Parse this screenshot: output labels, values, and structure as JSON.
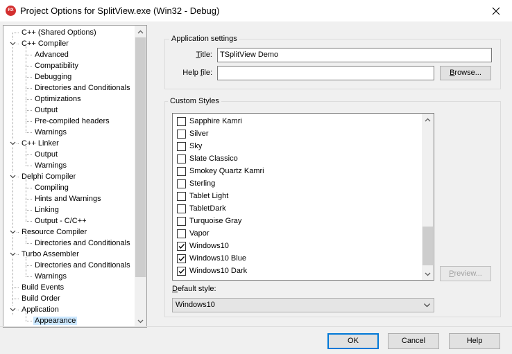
{
  "window": {
    "title": "Project Options for SplitView.exe  (Win32 - Debug)",
    "logo_text": "RX"
  },
  "tree": {
    "items": [
      {
        "label": "C++ (Shared Options)",
        "level": 0,
        "expander": "none"
      },
      {
        "label": "C++ Compiler",
        "level": 0,
        "expander": "expanded"
      },
      {
        "label": "Advanced",
        "level": 1
      },
      {
        "label": "Compatibility",
        "level": 1
      },
      {
        "label": "Debugging",
        "level": 1
      },
      {
        "label": "Directories and Conditionals",
        "level": 1
      },
      {
        "label": "Optimizations",
        "level": 1
      },
      {
        "label": "Output",
        "level": 1
      },
      {
        "label": "Pre-compiled headers",
        "level": 1
      },
      {
        "label": "Warnings",
        "level": 1
      },
      {
        "label": "C++ Linker",
        "level": 0,
        "expander": "expanded"
      },
      {
        "label": "Output",
        "level": 1
      },
      {
        "label": "Warnings",
        "level": 1
      },
      {
        "label": "Delphi Compiler",
        "level": 0,
        "expander": "expanded"
      },
      {
        "label": "Compiling",
        "level": 1
      },
      {
        "label": "Hints and Warnings",
        "level": 1
      },
      {
        "label": "Linking",
        "level": 1
      },
      {
        "label": "Output - C/C++",
        "level": 1
      },
      {
        "label": "Resource Compiler",
        "level": 0,
        "expander": "expanded"
      },
      {
        "label": "Directories and Conditionals",
        "level": 1
      },
      {
        "label": "Turbo Assembler",
        "level": 0,
        "expander": "expanded"
      },
      {
        "label": "Directories and Conditionals",
        "level": 1
      },
      {
        "label": "Warnings",
        "level": 1
      },
      {
        "label": "Build Events",
        "level": 0,
        "expander": "none"
      },
      {
        "label": "Build Order",
        "level": 0,
        "expander": "none"
      },
      {
        "label": "Application",
        "level": 0,
        "expander": "expanded"
      },
      {
        "label": "Appearance",
        "level": 1,
        "selected": true
      }
    ]
  },
  "app_settings": {
    "caption": "Application settings",
    "title_label_pre": "",
    "title_label_accel": "T",
    "title_label_post": "itle:",
    "title_value": "TSplitView Demo",
    "helpfile_label_pre": "Help ",
    "helpfile_label_accel": "f",
    "helpfile_label_post": "ile:",
    "helpfile_value": "",
    "browse_pre": "",
    "browse_accel": "B",
    "browse_post": "rowse..."
  },
  "custom_styles": {
    "caption": "Custom Styles",
    "items": [
      {
        "label": "Sapphire Kamri",
        "checked": false
      },
      {
        "label": "Silver",
        "checked": false
      },
      {
        "label": "Sky",
        "checked": false
      },
      {
        "label": "Slate Classico",
        "checked": false
      },
      {
        "label": "Smokey Quartz Kamri",
        "checked": false
      },
      {
        "label": "Sterling",
        "checked": false
      },
      {
        "label": "Tablet Light",
        "checked": false
      },
      {
        "label": "TabletDark",
        "checked": false
      },
      {
        "label": "Turquoise Gray",
        "checked": false
      },
      {
        "label": "Vapor",
        "checked": false
      },
      {
        "label": "Windows10",
        "checked": true
      },
      {
        "label": "Windows10 Blue",
        "checked": true
      },
      {
        "label": "Windows10 Dark",
        "checked": true
      }
    ],
    "preview_pre": "",
    "preview_accel": "P",
    "preview_post": "review..."
  },
  "default_style": {
    "label_pre": "",
    "label_accel": "D",
    "label_post": "efault style:",
    "value": "Windows10"
  },
  "footer": {
    "ok": "OK",
    "cancel": "Cancel",
    "help": "Help"
  },
  "colors": {
    "selection": "#cce8ff",
    "accent": "#0078d7",
    "logo": "#d32f2f"
  }
}
